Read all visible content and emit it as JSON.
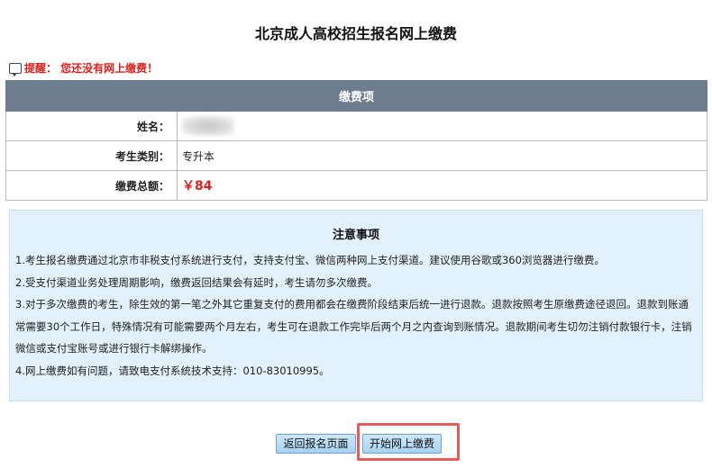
{
  "page": {
    "title": "北京成人高校招生报名网上缴费",
    "warning": "提醒：  您还没有网上缴费！"
  },
  "fee_table": {
    "header": "缴费项",
    "rows": [
      {
        "label": "姓名：",
        "value": ""
      },
      {
        "label": "考生类别：",
        "value": "专升本"
      },
      {
        "label": "缴费总额：",
        "value": "￥84"
      }
    ]
  },
  "notice": {
    "title": "注意事项",
    "items": [
      "1.考生报名缴费通过北京市非税支付系统进行支付，支持支付宝、微信两种网上支付渠道。建议使用谷歌或360浏览器进行缴费。",
      "2.受支付渠道业务处理周期影响，缴费返回结果会有延时，考生请勿多次缴费。",
      "3.对于多次缴费的考生，除生效的第一笔之外其它重复支付的费用都会在缴费阶段结束后统一进行退款。退款按照考生原缴费途径退回。退款到账通常需要30个工作日，特殊情况有可能需要两个月左右，考生可在退款工作完毕后两个月之内查询到账情况。退款期间考生切勿注销付款银行卡，注销微信或支付宝账号或进行银行卡解绑操作。",
      "4.网上缴费如有问题，请致电支付系统技术支持：010-83010995。"
    ]
  },
  "actions": {
    "back_label": "返回报名页面",
    "pay_label": "开始网上缴费"
  },
  "colors": {
    "table_header": "#6d7d8d",
    "notice_bg": "#e3f1fc",
    "warning_red": "#e0211b",
    "highlight_frame": "#e35d5b"
  }
}
